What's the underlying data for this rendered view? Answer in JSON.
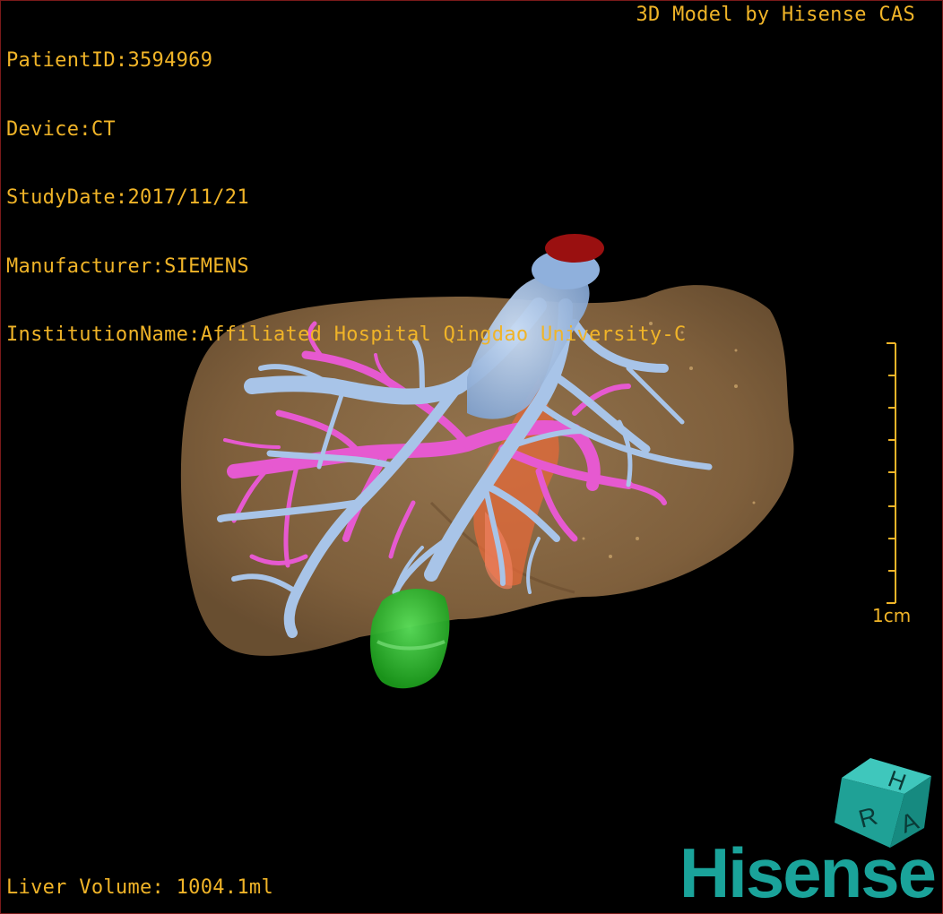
{
  "patient": {
    "id_line": "PatientID:3594969",
    "device_line": "Device:CT",
    "study_date_line": "StudyDate:2017/11/21",
    "manufacturer_line": "Manufacturer:SIEMENS",
    "institution_line": "InstitutionName:Affiliated Hospital Qingdao University-C"
  },
  "credit": "3D Model by Hisense CAS",
  "scale": {
    "label": "1cm"
  },
  "footer": {
    "volume_text": "Liver Volume: 1004.1ml"
  },
  "orientation_cube": {
    "faces": [
      "H",
      "R",
      "A"
    ]
  },
  "logo_text": "Hisense",
  "colors": {
    "overlay_text": "#f0b428",
    "liver": "#8a6a44",
    "hepatic_vein": "#a8c4e8",
    "portal_vein": "#e659d0",
    "artery": "#e46a3a",
    "gallbladder": "#2fc22f",
    "vena_cava_top": "#9a1010",
    "brand": "#1aa39a"
  }
}
